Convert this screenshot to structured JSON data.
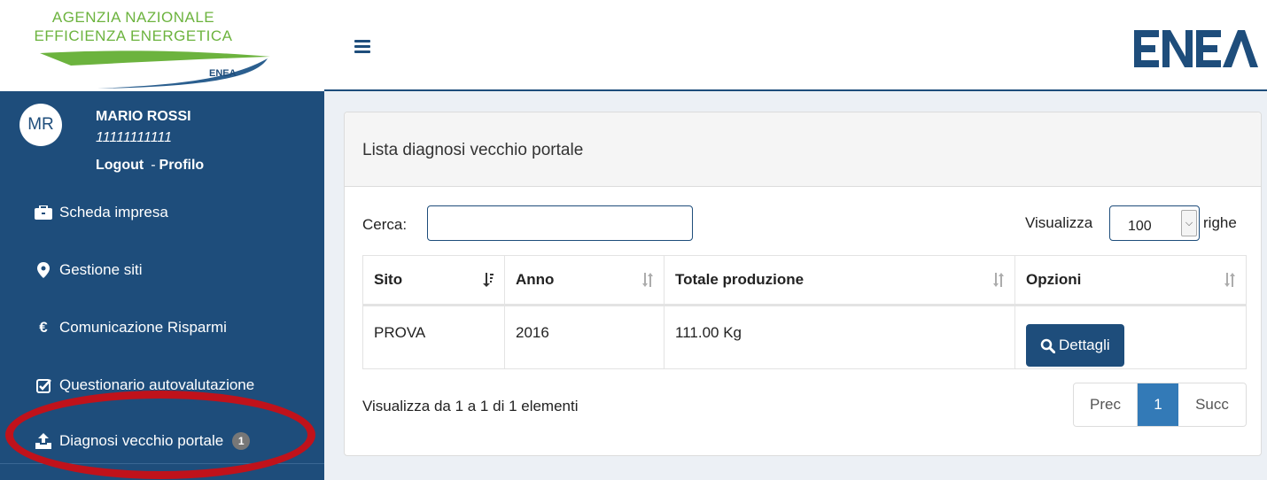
{
  "brand": {
    "line1": "AGENZIA NAZIONALE",
    "line2": "EFFICIENZA ENERGETICA",
    "mark": "ENEA"
  },
  "header": {
    "menu_icon": "hamburger-icon",
    "logo": "ENEA"
  },
  "user": {
    "initials": "MR",
    "name": "MARIO ROSSI",
    "id": "11111111111",
    "logout": "Logout",
    "separator": "-",
    "profile": "Profilo"
  },
  "sidebar": {
    "items": [
      {
        "icon": "briefcase-icon",
        "label": "Scheda impresa"
      },
      {
        "icon": "map-marker-icon",
        "label": "Gestione siti"
      },
      {
        "icon": "euro-icon",
        "label": "Comunicazione Risparmi"
      },
      {
        "icon": "checkbox-icon",
        "label": "Questionario autovalutazione"
      },
      {
        "icon": "upload-icon",
        "label": "Diagnosi vecchio portale",
        "badge": "1"
      }
    ]
  },
  "panel": {
    "title": "Lista diagnosi vecchio portale",
    "search_label": "Cerca:",
    "search_value": "",
    "length_label": "Visualizza",
    "length_value": "100",
    "length_suffix": "righe",
    "columns": [
      "Sito",
      "Anno",
      "Totale produzione",
      "Opzioni"
    ],
    "rows": [
      {
        "sito": "PROVA",
        "anno": "2016",
        "totale": "111.00 Kg",
        "action": "Dettagli"
      }
    ],
    "info": "Visualizza da 1 a 1 di 1 elementi",
    "pager": {
      "prev": "Prec",
      "current": "1",
      "next": "Succ"
    }
  },
  "colors": {
    "sidebar": "#1e4d7b",
    "content_bg": "#ecf0f5",
    "brand_green": "#6cb33e",
    "highlight": "#c0121b",
    "active_page": "#337ab7"
  }
}
